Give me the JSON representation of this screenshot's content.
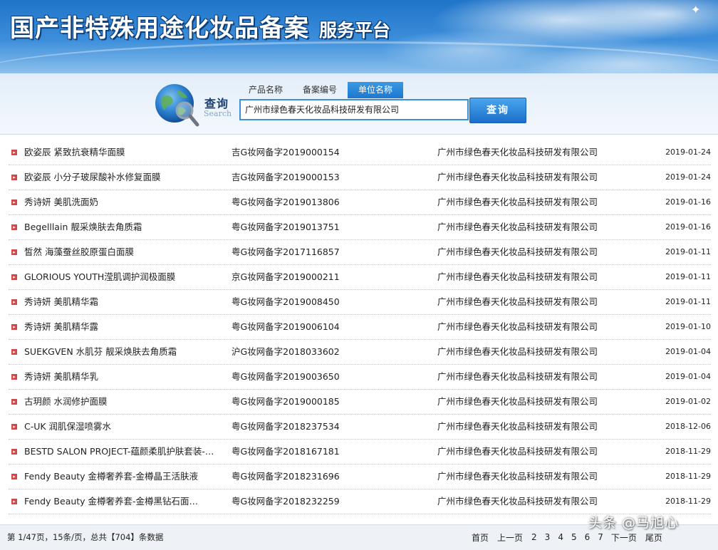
{
  "header": {
    "title": "国产非特殊用途化妆品备案",
    "subtitle": "服务平台"
  },
  "search": {
    "label": "查询",
    "label_en": "Search",
    "tabs": [
      {
        "label": "产品名称",
        "active": false
      },
      {
        "label": "备案编号",
        "active": false
      },
      {
        "label": "单位名称",
        "active": true
      }
    ],
    "value": "广州市绿色春天化妆品科技研发有限公司",
    "button_label": "查询"
  },
  "results": [
    {
      "name": "欧姿辰 紧致抗衰精华面膜",
      "reg": "吉G妆网备字2019000154",
      "company": "广州市绿色春天化妆品科技研发有限公司",
      "date": "2019-01-24"
    },
    {
      "name": "欧姿辰 小分子玻尿酸补水修复面膜",
      "reg": "吉G妆网备字2019000153",
      "company": "广州市绿色春天化妆品科技研发有限公司",
      "date": "2019-01-24"
    },
    {
      "name": "秀诗妍 美肌洗面奶",
      "reg": "粤G妆网备字2019013806",
      "company": "广州市绿色春天化妆品科技研发有限公司",
      "date": "2019-01-16"
    },
    {
      "name": "Begelllain 靓采焕肤去角质霜",
      "reg": "粤G妆网备字2019013751",
      "company": "广州市绿色春天化妆品科技研发有限公司",
      "date": "2019-01-16"
    },
    {
      "name": "皙然 海藻蚕丝胶原蛋白面膜",
      "reg": "粤G妆网备字2017116857",
      "company": "广州市绿色春天化妆品科技研发有限公司",
      "date": "2019-01-11"
    },
    {
      "name": "GLORIOUS YOUTH滢肌调护润极面膜",
      "reg": "京G妆网备字2019000211",
      "company": "广州市绿色春天化妆品科技研发有限公司",
      "date": "2019-01-11"
    },
    {
      "name": "秀诗妍 美肌精华霜",
      "reg": "粤G妆网备字2019008450",
      "company": "广州市绿色春天化妆品科技研发有限公司",
      "date": "2019-01-11"
    },
    {
      "name": "秀诗妍 美肌精华露",
      "reg": "粤G妆网备字2019006104",
      "company": "广州市绿色春天化妆品科技研发有限公司",
      "date": "2019-01-10"
    },
    {
      "name": "SUEKGVEN 水肌芬 靓采焕肤去角质霜",
      "reg": "沪G妆网备字2018033602",
      "company": "广州市绿色春天化妆品科技研发有限公司",
      "date": "2019-01-04"
    },
    {
      "name": "秀诗妍 美肌精华乳",
      "reg": "粤G妆网备字2019003650",
      "company": "广州市绿色春天化妆品科技研发有限公司",
      "date": "2019-01-04"
    },
    {
      "name": "古玥颜 水润修护面膜",
      "reg": "粤G妆网备字2019000185",
      "company": "广州市绿色春天化妆品科技研发有限公司",
      "date": "2019-01-02"
    },
    {
      "name": "C-UK 润肌保湿喷雾水",
      "reg": "粤G妆网备字2018237534",
      "company": "广州市绿色春天化妆品科技研发有限公司",
      "date": "2018-12-06"
    },
    {
      "name": "BESTD SALON PROJECT-蕴颜柔肌护肤套装-…",
      "reg": "粤G妆网备字2018167181",
      "company": "广州市绿色春天化妆品科技研发有限公司",
      "date": "2018-11-29"
    },
    {
      "name": "Fendy Beauty 金樽奢养套-金樽晶王活肤液",
      "reg": "粤G妆网备字2018231696",
      "company": "广州市绿色春天化妆品科技研发有限公司",
      "date": "2018-11-29"
    },
    {
      "name": "Fendy Beauty 金樽奢养套-金樽黑钻石面…",
      "reg": "粤G妆网备字2018232259",
      "company": "广州市绿色春天化妆品科技研发有限公司",
      "date": "2018-11-29"
    }
  ],
  "footer": {
    "summary": "第 1/47页，15条/页，总共【704】条数据",
    "first": "首页",
    "prev": "上一页",
    "pages": [
      "2",
      "3",
      "4",
      "5",
      "6",
      "7"
    ],
    "next": "下一页",
    "last": "尾页"
  },
  "watermark": "头条 @马旭心",
  "colors": {
    "banner_blue": "#1f74c9",
    "accent_blue": "#1e78cf",
    "bullet_red": "#d24747"
  }
}
